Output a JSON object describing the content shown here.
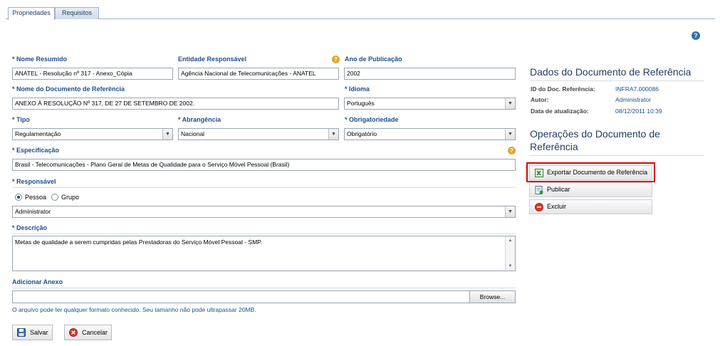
{
  "tabs": [
    {
      "label": "Propriedades"
    },
    {
      "label": "Requisitos"
    }
  ],
  "top_help": "?",
  "form": {
    "nome_resumido": {
      "label": "* Nome Resumido",
      "value": "ANATEL - Resolução nº 317 - Anexo_Cópia"
    },
    "entidade": {
      "label": "Entidade Responsável",
      "value": "Agência Nacional de Telecomunicações - ANATEL"
    },
    "ano": {
      "label": "Ano de Publicação",
      "value": "2002"
    },
    "nome_documento": {
      "label": "* Nome do Documento de Referência",
      "value": "ANEXO À RESOLUÇÃO Nº 317, DE 27 DE SETEMBRO DE 2002."
    },
    "idioma": {
      "label": "* Idioma",
      "value": "Português"
    },
    "tipo": {
      "label": "* Tipo",
      "value": "Regulamentação"
    },
    "abrangencia": {
      "label": "* Abrangência",
      "value": "Nacional"
    },
    "obrigatoriedade": {
      "label": "* Obrigatoriedade",
      "value": "Obrigatório"
    },
    "especificacao": {
      "label": "* Especificação",
      "value": "Brasil - Telecomunicações - Plano Geral de Metas de Qualidade para o Serviço Móvel Pessoal (Brasil)"
    },
    "responsavel": {
      "label": "* Responsável",
      "radio_pessoa": "Pessoa",
      "radio_grupo": "Grupo",
      "value": "Administrator"
    },
    "descricao": {
      "label": "* Descrição",
      "value": "Metas de qualidade a serem cumpridas pelas Prestadoras do Serviço Móvel Pessoal - SMP."
    },
    "anexo": {
      "label": "Adicionar Anexo",
      "value": "",
      "browse": "Browse...",
      "hint": "O arquivo pode ter qualquer formato conhecido. Seu tamanho não pode ultrapassar 20MB."
    },
    "help_glyph": "?"
  },
  "buttons": {
    "salvar": "Salvar",
    "cancelar": "Cancelar"
  },
  "sidebar": {
    "dados_title": "Dados do Documento de Referência",
    "meta": [
      {
        "label": "ID do Doc. Referência:",
        "value": "INFRA7.000086"
      },
      {
        "label": "Autor:",
        "value": "Administrator"
      },
      {
        "label": "Data de atualização:",
        "value": "08/12/2011 10:39"
      }
    ],
    "operacoes_title_1": "Operações do Documento de",
    "operacoes_title_2": "Referência",
    "operations": [
      {
        "label": "Exportar Documento de Referência",
        "icon": "excel-export-icon"
      },
      {
        "label": "Publicar",
        "icon": "publish-icon"
      },
      {
        "label": "Excluir",
        "icon": "delete-icon"
      }
    ]
  },
  "colors": {
    "label": "#1f4f8a",
    "highlight": "#d90000"
  }
}
